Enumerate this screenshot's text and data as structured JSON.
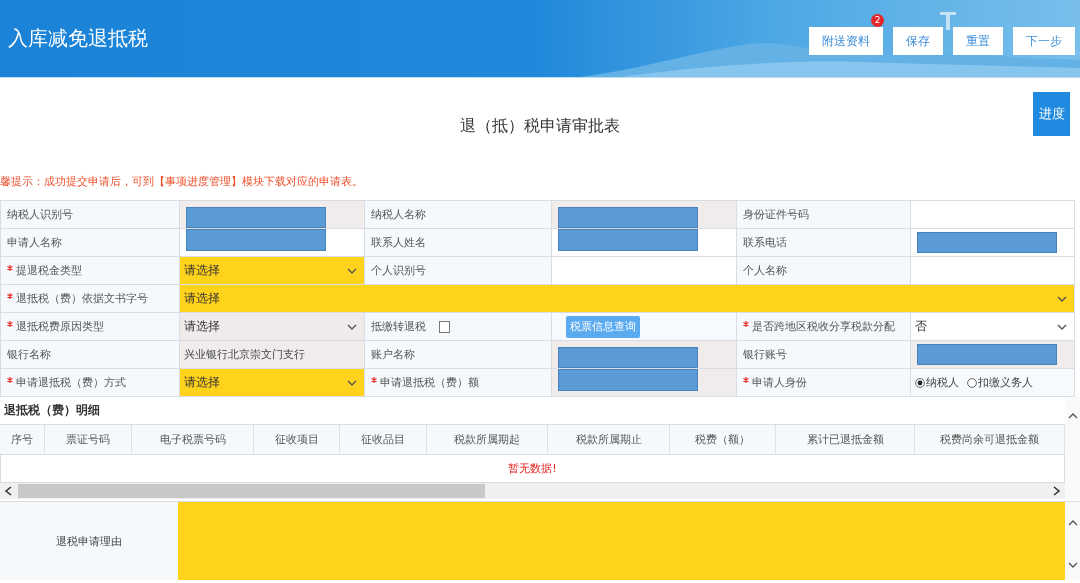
{
  "header": {
    "title": "入库减免退抵税",
    "buttons": [
      {
        "label": "附送资料",
        "badge": "2"
      },
      {
        "label": "保存"
      },
      {
        "label": "重置"
      },
      {
        "label": "下一步"
      }
    ]
  },
  "page": {
    "title": "退（抵）税申请审批表",
    "progress_button": "进度",
    "notice": "馨提示：成功提交申请后，可到【事项进度管理】模块下载对应的申请表。"
  },
  "form": {
    "rows": [
      [
        {
          "kind": "label",
          "text": "纳税人识别号",
          "required": false
        },
        {
          "kind": "text",
          "readonly": true,
          "redacted": true
        },
        {
          "kind": "label",
          "text": "纳税人名称",
          "required": false
        },
        {
          "kind": "text",
          "readonly": true,
          "redacted": true
        },
        {
          "kind": "label",
          "text": "身份证件号码",
          "required": false
        },
        {
          "kind": "text",
          "readonly": false
        }
      ],
      [
        {
          "kind": "label",
          "text": "申请人名称",
          "required": false
        },
        {
          "kind": "text",
          "readonly": false,
          "redacted": true
        },
        {
          "kind": "label",
          "text": "联系人姓名",
          "required": false
        },
        {
          "kind": "text",
          "readonly": false,
          "redacted": true
        },
        {
          "kind": "label",
          "text": "联系电话",
          "required": false
        },
        {
          "kind": "text",
          "readonly": false,
          "redacted": true
        }
      ],
      [
        {
          "kind": "label",
          "text": "提退税金类型",
          "required": true
        },
        {
          "kind": "select",
          "value": "请选择",
          "highlight": true,
          "readonly": false
        },
        {
          "kind": "label",
          "text": "个人识别号",
          "required": false
        },
        {
          "kind": "text",
          "readonly": false
        },
        {
          "kind": "label",
          "text": "个人名称",
          "required": false
        },
        {
          "kind": "text",
          "readonly": false
        }
      ],
      [
        {
          "kind": "label",
          "text": "退抵税（费）依据文书字号",
          "required": true
        },
        {
          "kind": "select",
          "value": "请选择",
          "highlight": true,
          "readonly": false,
          "colspan": 5
        }
      ],
      [
        {
          "kind": "label",
          "text": "退抵税费原因类型",
          "required": true
        },
        {
          "kind": "select",
          "value": "请选择",
          "highlight": false,
          "readonly": true
        },
        {
          "kind": "label",
          "text": "抵缴转退税",
          "required": false,
          "checkbox": {
            "checked": false
          }
        },
        {
          "kind": "button",
          "label": "税票信息查询"
        },
        {
          "kind": "label",
          "text": "是否跨地区税收分享税款分配",
          "required": true
        },
        {
          "kind": "select",
          "value": "否",
          "highlight": false,
          "readonly": false
        }
      ],
      [
        {
          "kind": "label",
          "text": "银行名称",
          "required": false
        },
        {
          "kind": "text",
          "value": "兴业银行北京崇文门支行",
          "readonly": true
        },
        {
          "kind": "label",
          "text": "账户名称",
          "required": false
        },
        {
          "kind": "text",
          "readonly": true,
          "redacted": true
        },
        {
          "kind": "label",
          "text": "银行账号",
          "required": false
        },
        {
          "kind": "text",
          "readonly": true,
          "redacted": true
        }
      ],
      [
        {
          "kind": "label",
          "text": "申请退抵税（费）方式",
          "required": true
        },
        {
          "kind": "select",
          "value": "请选择",
          "highlight": true,
          "readonly": false
        },
        {
          "kind": "label",
          "text": "申请退抵税（费）额",
          "required": true
        },
        {
          "kind": "text",
          "readonly": true,
          "redacted": true
        },
        {
          "kind": "label",
          "text": "申请人身份",
          "required": true
        },
        {
          "kind": "radio",
          "options": [
            {
              "label": "纳税人",
              "selected": true
            },
            {
              "label": "扣缴义务人",
              "selected": false
            }
          ]
        }
      ]
    ]
  },
  "detail": {
    "title": "退抵税（费）明细",
    "columns": [
      "序号",
      "票证号码",
      "电子税票号码",
      "征收项目",
      "征收品目",
      "税款所属期起",
      "税款所属期止",
      "税费（额）",
      "累计已退抵金额",
      "税费尚余可退抵金额"
    ],
    "empty_text": "暂无数据!"
  },
  "reason": {
    "label": "退税申请理由",
    "highlight": true
  }
}
